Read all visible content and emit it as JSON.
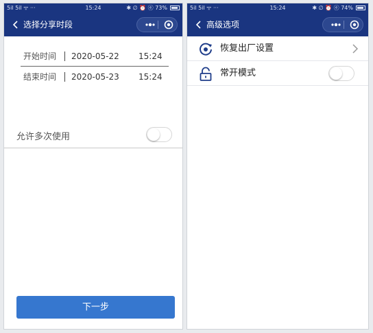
{
  "left": {
    "status": {
      "signal": "5il 5il ᯤ ···",
      "time": "15:24",
      "icons": "✱ ∅ ⏰ ⓔ 73%",
      "battery_level": 0.73
    },
    "nav": {
      "title": "选择分享时段"
    },
    "start": {
      "label": "开始时间",
      "date": "2020-05-22",
      "time": "15:24"
    },
    "end": {
      "label": "结束时间",
      "date": "2020-05-23",
      "time": "15:24"
    },
    "allow_multi": {
      "label": "允许多次使用",
      "on": false
    },
    "next_button": "下一步"
  },
  "right": {
    "status": {
      "signal": "5il 5il ᯤ ···",
      "time": "15:24",
      "icons": "✱ ∅ ⏰ ⓔ 74%",
      "battery_level": 0.74
    },
    "nav": {
      "title": "高级选项"
    },
    "items": [
      {
        "label": "恢复出厂设置",
        "icon": "restore-disc-icon"
      },
      {
        "label": "常开模式",
        "icon": "unlock-icon",
        "toggle_on": false
      }
    ]
  },
  "colors": {
    "nav_bg": "#1a3580",
    "primary_button": "#3677cf",
    "icon_blue": "#1f3d8a"
  }
}
